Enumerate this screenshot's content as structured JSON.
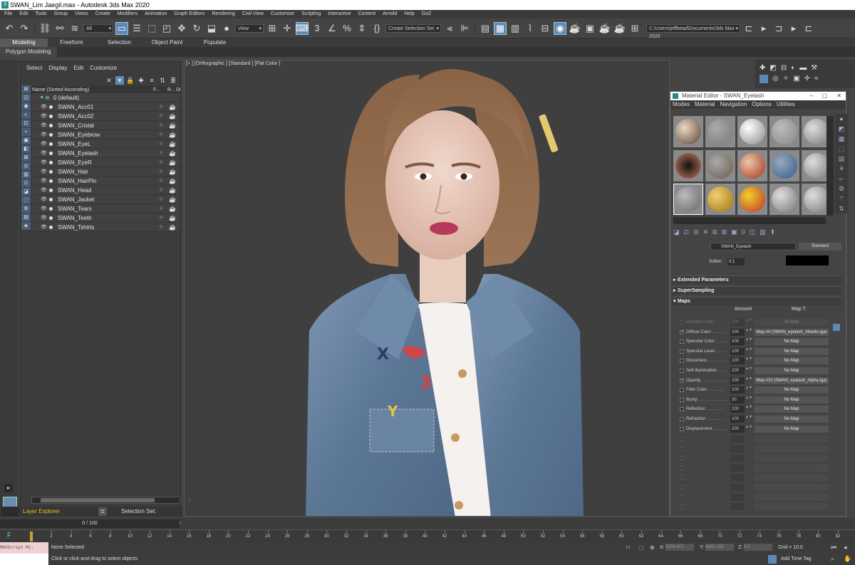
{
  "window": {
    "title": "SWAN_Lim Jaegil.max - Autodesk 3ds Max 2020"
  },
  "menu": [
    "File",
    "Edit",
    "Tools",
    "Group",
    "Views",
    "Create",
    "Modifiers",
    "Animation",
    "Graph Editors",
    "Rendering",
    "Civil View",
    "Customize",
    "Scripting",
    "Interactive",
    "Content",
    "Arnold",
    "Help",
    "GoZ"
  ],
  "toolbar": {
    "selection_filter": "All",
    "view_dropdown": "View",
    "selection_set": "Create Selection Set",
    "project_path": "C:\\Users\\jeffbead\\Documents\\3ds Max 2020"
  },
  "ribbon": {
    "tabs": [
      "Modeling",
      "Freeform",
      "Selection",
      "Object Paint",
      "Populate"
    ],
    "active": "Modeling",
    "subtab": "Polygon Modeling"
  },
  "scene_explorer": {
    "menus": [
      "Select",
      "Display",
      "Edit",
      "Customize"
    ],
    "column_header": "Name (Sorted Ascending)",
    "col_f": "F...",
    "col_r": "R...",
    "col_d": "Di",
    "root": "0 (default)",
    "objects": [
      "SWAN_Acc01",
      "SWAN_Acc02",
      "SWAN_Cristal",
      "SWAN_Eyebrow",
      "SWAN_EyeL",
      "SWAN_Eyelash",
      "SWAN_EyeR",
      "SWAN_Hair",
      "SWAN_HairPin",
      "SWAN_Head",
      "SWAN_Jacket",
      "SWAN_Tears",
      "SWAN_Teeth",
      "SWAN_Tshirts"
    ],
    "layer_explorer": "Layer Explorer",
    "selection_set_label": "Selection Set:"
  },
  "viewport": {
    "label": "[+ ] [Orthographic ] [Standard ] [Flat Color ]"
  },
  "material_editor": {
    "title": "Material Editor - SWAN_Eyelash",
    "menus": [
      "Modes",
      "Material",
      "Navigation",
      "Options",
      "Utilities"
    ],
    "material_name": "SWAN_Eyelash",
    "material_type": "Standard",
    "soften_label": "Soften:",
    "soften_value": "0.1",
    "rollouts": [
      "Extended Parameters",
      "SuperSampling",
      "Maps"
    ],
    "maps_amount_header": "Amount",
    "maps_type_header": "Map T",
    "maps": [
      {
        "label": "Ambient Color . . . . . .",
        "amount": "100",
        "map": "No Map",
        "checked": false,
        "dim": true
      },
      {
        "label": "Diffuse Color . . . . . .",
        "amount": "100",
        "map": "Map #4 (SWAN_eyelash_Albedo.tga)",
        "checked": true,
        "dim": false
      },
      {
        "label": "Specular Color . . . . .",
        "amount": "100",
        "map": "No Map",
        "checked": false,
        "dim": false
      },
      {
        "label": "Specular Level . . . . .",
        "amount": "100",
        "map": "No Map",
        "checked": false,
        "dim": false
      },
      {
        "label": "Glossiness . . . . . . . .",
        "amount": "100",
        "map": "No Map",
        "checked": false,
        "dim": false
      },
      {
        "label": "Self-Illumination . . . .",
        "amount": "100",
        "map": "No Map",
        "checked": false,
        "dim": false
      },
      {
        "label": "Opacity . . . . . . . . . . .",
        "amount": "100",
        "map": "Map #15 (SWAN_eyelash_Alpha.tga)",
        "checked": true,
        "dim": false
      },
      {
        "label": "Filter Color . . . . . . .",
        "amount": "100",
        "map": "No Map",
        "checked": false,
        "dim": false
      },
      {
        "label": "Bump . . . . . . . . . . . .",
        "amount": "30",
        "map": "No Map",
        "checked": false,
        "dim": false
      },
      {
        "label": "Reflection . . . . . . . .",
        "amount": "100",
        "map": "No Map",
        "checked": false,
        "dim": false
      },
      {
        "label": "Refraction . . . . . . . .",
        "amount": "100",
        "map": "No Map",
        "checked": false,
        "dim": false
      },
      {
        "label": "Displacement . . . . . .",
        "amount": "100",
        "map": "No Map",
        "checked": false,
        "dim": false
      }
    ]
  },
  "timeline": {
    "frame_display": "0 / 100",
    "ticks": [
      "2",
      "4",
      "6",
      "8",
      "10",
      "12",
      "14",
      "16",
      "18",
      "20",
      "22",
      "24",
      "26",
      "28",
      "30",
      "32",
      "34",
      "36",
      "38",
      "40",
      "42",
      "44",
      "46",
      "48",
      "50",
      "52",
      "54",
      "56",
      "58",
      "60",
      "62",
      "64",
      "66",
      "68",
      "70",
      "72",
      "74",
      "76",
      "78",
      "80",
      "82"
    ]
  },
  "status": {
    "maxscript": "MAXScript Mi:",
    "selected": "None Selected",
    "prompt": "Click or click-and-drag to select objects",
    "x_label": "X:",
    "x_val": "3209.472",
    "y_label": "Y:",
    "y_val": "8682.158",
    "z_label": "Z:",
    "z_val": "0.0",
    "grid": "Grid = 10.0",
    "time_tag": "Add Time Tag"
  }
}
